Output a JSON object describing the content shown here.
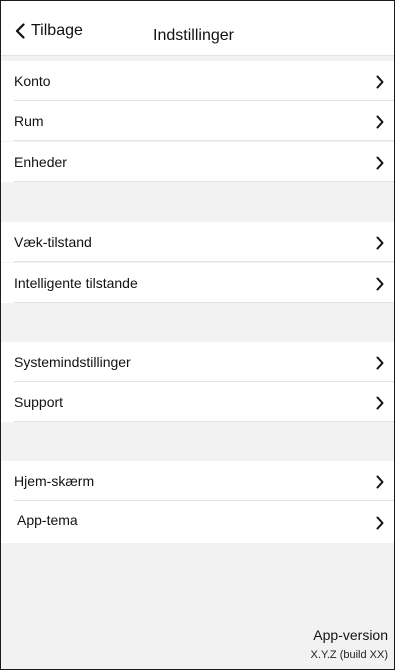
{
  "header": {
    "back_label": "Tilbage",
    "title": "Indstillinger"
  },
  "groups": [
    {
      "items": [
        {
          "label": "Konto"
        },
        {
          "label": "Rum"
        },
        {
          "label": "Enheder"
        }
      ]
    },
    {
      "items": [
        {
          "label": "Væk-tilstand"
        },
        {
          "label": "Intelligente tilstande"
        }
      ]
    },
    {
      "items": [
        {
          "label": "Systemindstillinger"
        },
        {
          "label": "Support"
        }
      ]
    },
    {
      "items": [
        {
          "label": "Hjem-skærm"
        },
        {
          "label": "App-tema"
        }
      ]
    }
  ],
  "footer": {
    "version_label": "App-version",
    "version_value": "X.Y.Z (build XX)"
  },
  "icons": {
    "back": "chevron-left-icon",
    "row": "chevron-right-icon"
  }
}
